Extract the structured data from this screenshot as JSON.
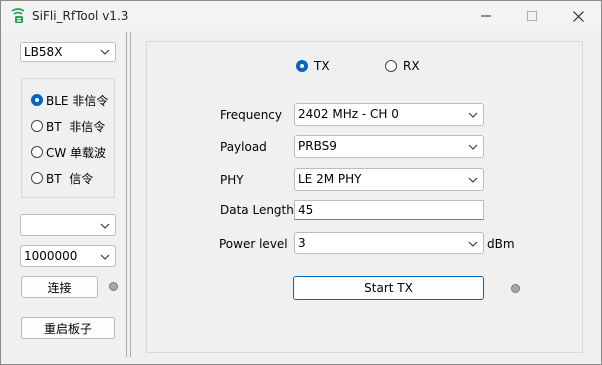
{
  "window": {
    "title": "SiFli_RfTool v1.3"
  },
  "left": {
    "chip_select": {
      "value": "LB58X"
    },
    "mode_options": [
      {
        "label": "BLE 非信令",
        "checked": true
      },
      {
        "label": "BT  非信令",
        "checked": false
      },
      {
        "label": "CW 单载波",
        "checked": false
      },
      {
        "label": "BT  信令",
        "checked": false
      }
    ],
    "port_select": {
      "value": ""
    },
    "baud_select": {
      "value": "1000000"
    },
    "connect_label": "连接",
    "reboot_label": "重启板子"
  },
  "main": {
    "tx_label": "TX",
    "rx_label": "RX",
    "tx_checked": true,
    "frequency": {
      "label": "Frequency",
      "value": "2402 MHz - CH 0"
    },
    "payload": {
      "label": "Payload",
      "value": "PRBS9"
    },
    "phy": {
      "label": "PHY",
      "value": "LE 2M PHY"
    },
    "data_length": {
      "label": "Data Length",
      "value": "45"
    },
    "power_level": {
      "label": "Power level",
      "value": "3",
      "unit": "dBm"
    },
    "start_label": "Start TX"
  },
  "colors": {
    "accent": "#0067c0",
    "led_off": "#a7a7a7",
    "icon_green": "#2e9e58"
  }
}
